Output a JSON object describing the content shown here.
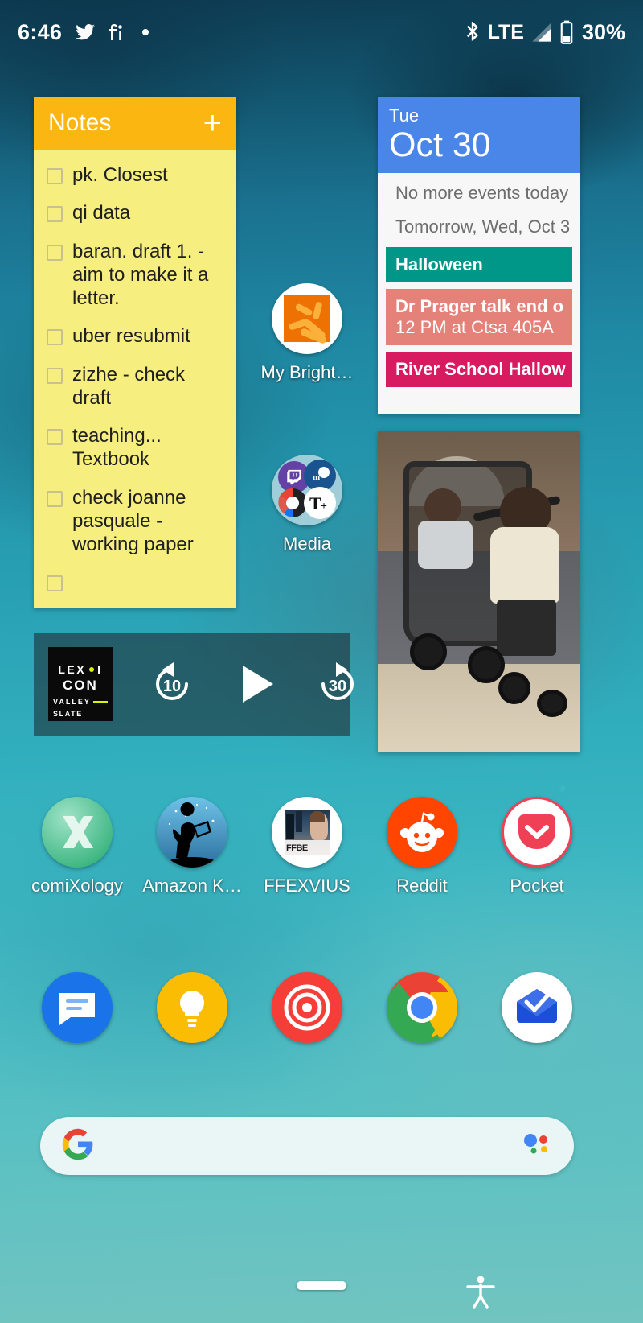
{
  "status_bar": {
    "clock": "6:46",
    "left_icons": [
      "twitter-icon",
      "google-fi-icon",
      "dot-icon"
    ],
    "right_icons": [
      "bluetooth-icon",
      "signal-icon",
      "battery-icon"
    ],
    "network_type": "LTE",
    "battery_percent": "30%"
  },
  "notes_widget": {
    "title": "Notes",
    "add_label": "+",
    "header_color": "#FBB612",
    "body_color": "#F6EE7F",
    "items": [
      {
        "text": "pk. Closest",
        "checked": false
      },
      {
        "text": "qi data",
        "checked": false
      },
      {
        "text": "baran. draft 1. - aim to make it a letter.",
        "checked": false
      },
      {
        "text": "uber resubmit",
        "checked": false
      },
      {
        "text": "zizhe - check draft",
        "checked": false
      },
      {
        "text": "teaching... Textbook",
        "checked": false
      },
      {
        "text": "check joanne pasquale - working paper",
        "checked": false
      },
      {
        "text": "",
        "checked": false
      }
    ]
  },
  "calendar_widget": {
    "weekday": "Tue",
    "date": "Oct 30",
    "header_color": "#4A86E8",
    "no_events_text": "No more events today",
    "tomorrow_text": "Tomorrow, Wed, Oct 3",
    "events": [
      {
        "title": "Halloween",
        "subtitle": "",
        "color": "#009688"
      },
      {
        "title": "Dr Prager talk end o",
        "subtitle": "12 PM at Ctsa 405A",
        "color": "#E4827A"
      },
      {
        "title": "River School Hallow",
        "subtitle": "",
        "color": "#D81B60"
      }
    ]
  },
  "photo_widget": {
    "name": "photo-frame-widget"
  },
  "podcast_widget": {
    "art": {
      "line1": "LEX",
      "line1b": "I",
      "line2": "CON",
      "line3": "VALLEY",
      "line4": "SLATE"
    },
    "rewind_label": "10",
    "forward_label": "30",
    "play_label": "play"
  },
  "mid_apps": [
    {
      "label": "My Bright…",
      "icon": "mybrightwheel-icon"
    },
    {
      "label": "Media",
      "icon": "media-folder-icon"
    }
  ],
  "app_row_1": [
    {
      "label": "comiXology",
      "icon": "comixology-icon"
    },
    {
      "label": "Amazon K…",
      "icon": "amazon-kindle-icon"
    },
    {
      "label": "FFEXVIUS",
      "icon": "ffexvius-icon"
    },
    {
      "label": "Reddit",
      "icon": "reddit-icon"
    },
    {
      "label": "Pocket",
      "icon": "pocket-icon"
    }
  ],
  "dock": [
    {
      "label": "",
      "icon": "messages-icon"
    },
    {
      "label": "",
      "icon": "google-keep-icon"
    },
    {
      "label": "",
      "icon": "pocket-casts-icon"
    },
    {
      "label": "",
      "icon": "chrome-icon"
    },
    {
      "label": "",
      "icon": "newton-mail-icon"
    }
  ],
  "search_bar": {
    "left_icon": "google-g-icon",
    "right_icon": "google-assistant-icon",
    "placeholder": ""
  },
  "nav_bar": {
    "home_pill": "home-gesture-pill",
    "accessibility": "accessibility-icon"
  }
}
